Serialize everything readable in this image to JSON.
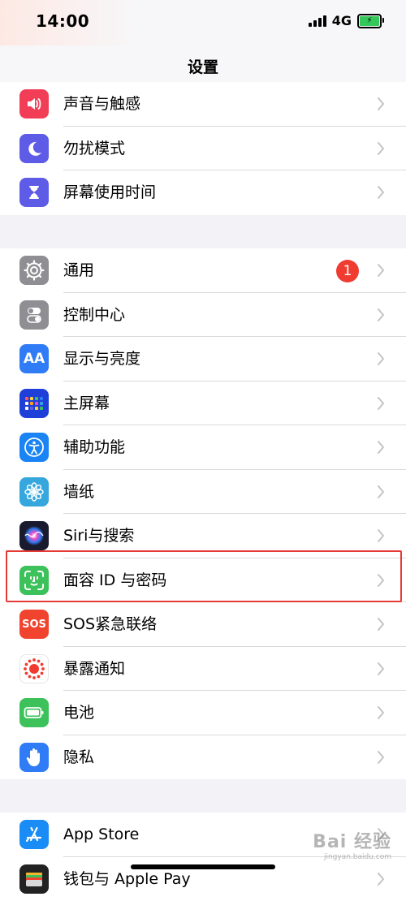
{
  "status_bar": {
    "time": "14:00",
    "network": "4G",
    "battery_icon": "battery-charging-icon"
  },
  "nav": {
    "title": "设置"
  },
  "colors": {
    "badge": "#f03b30",
    "highlight": "#e53935"
  },
  "group1": [
    {
      "label": "声音与触感",
      "icon": "speaker-icon",
      "color": "#f23d57"
    },
    {
      "label": "勿扰模式",
      "icon": "moon-icon",
      "color": "#5e5ce6"
    },
    {
      "label": "屏幕使用时间",
      "icon": "hourglass-icon",
      "color": "#5e5ce6"
    }
  ],
  "group2": [
    {
      "label": "通用",
      "icon": "gear-icon",
      "color": "#8e8e93",
      "badge": "1"
    },
    {
      "label": "控制中心",
      "icon": "toggle-icon",
      "color": "#8e8e93"
    },
    {
      "label": "显示与亮度",
      "icon": "text-size-icon",
      "color": "#2f7cf6",
      "icon_text": "AA"
    },
    {
      "label": "主屏幕",
      "icon": "grid-icon",
      "color": "#1f40d8"
    },
    {
      "label": "辅助功能",
      "icon": "accessibility-icon",
      "color": "#1a84f5"
    },
    {
      "label": "墙纸",
      "icon": "flower-icon",
      "color": "#35a7dd"
    },
    {
      "label": "Siri与搜索",
      "icon": "siri-icon",
      "color": "#1a1a2e"
    },
    {
      "label": "面容 ID 与密码",
      "icon": "face-id-icon",
      "color": "#3cc15b"
    },
    {
      "label": "SOS紧急联络",
      "icon": "sos-icon",
      "color": "#f0442f",
      "icon_text": "SOS"
    },
    {
      "label": "暴露通知",
      "icon": "exposure-icon",
      "color": "#ffffff"
    },
    {
      "label": "电池",
      "icon": "battery-icon",
      "color": "#3cc15b"
    },
    {
      "label": "隐私",
      "icon": "hand-icon",
      "color": "#2f7cf6"
    }
  ],
  "group3": [
    {
      "label": "App Store",
      "icon": "app-store-icon",
      "color": "#1a8cf5"
    },
    {
      "label": "钱包与 Apple Pay",
      "icon": "wallet-icon",
      "color": "#222222"
    }
  ],
  "watermark": {
    "main": "Bai 经验",
    "sub": "jingyan.baidu.com"
  }
}
